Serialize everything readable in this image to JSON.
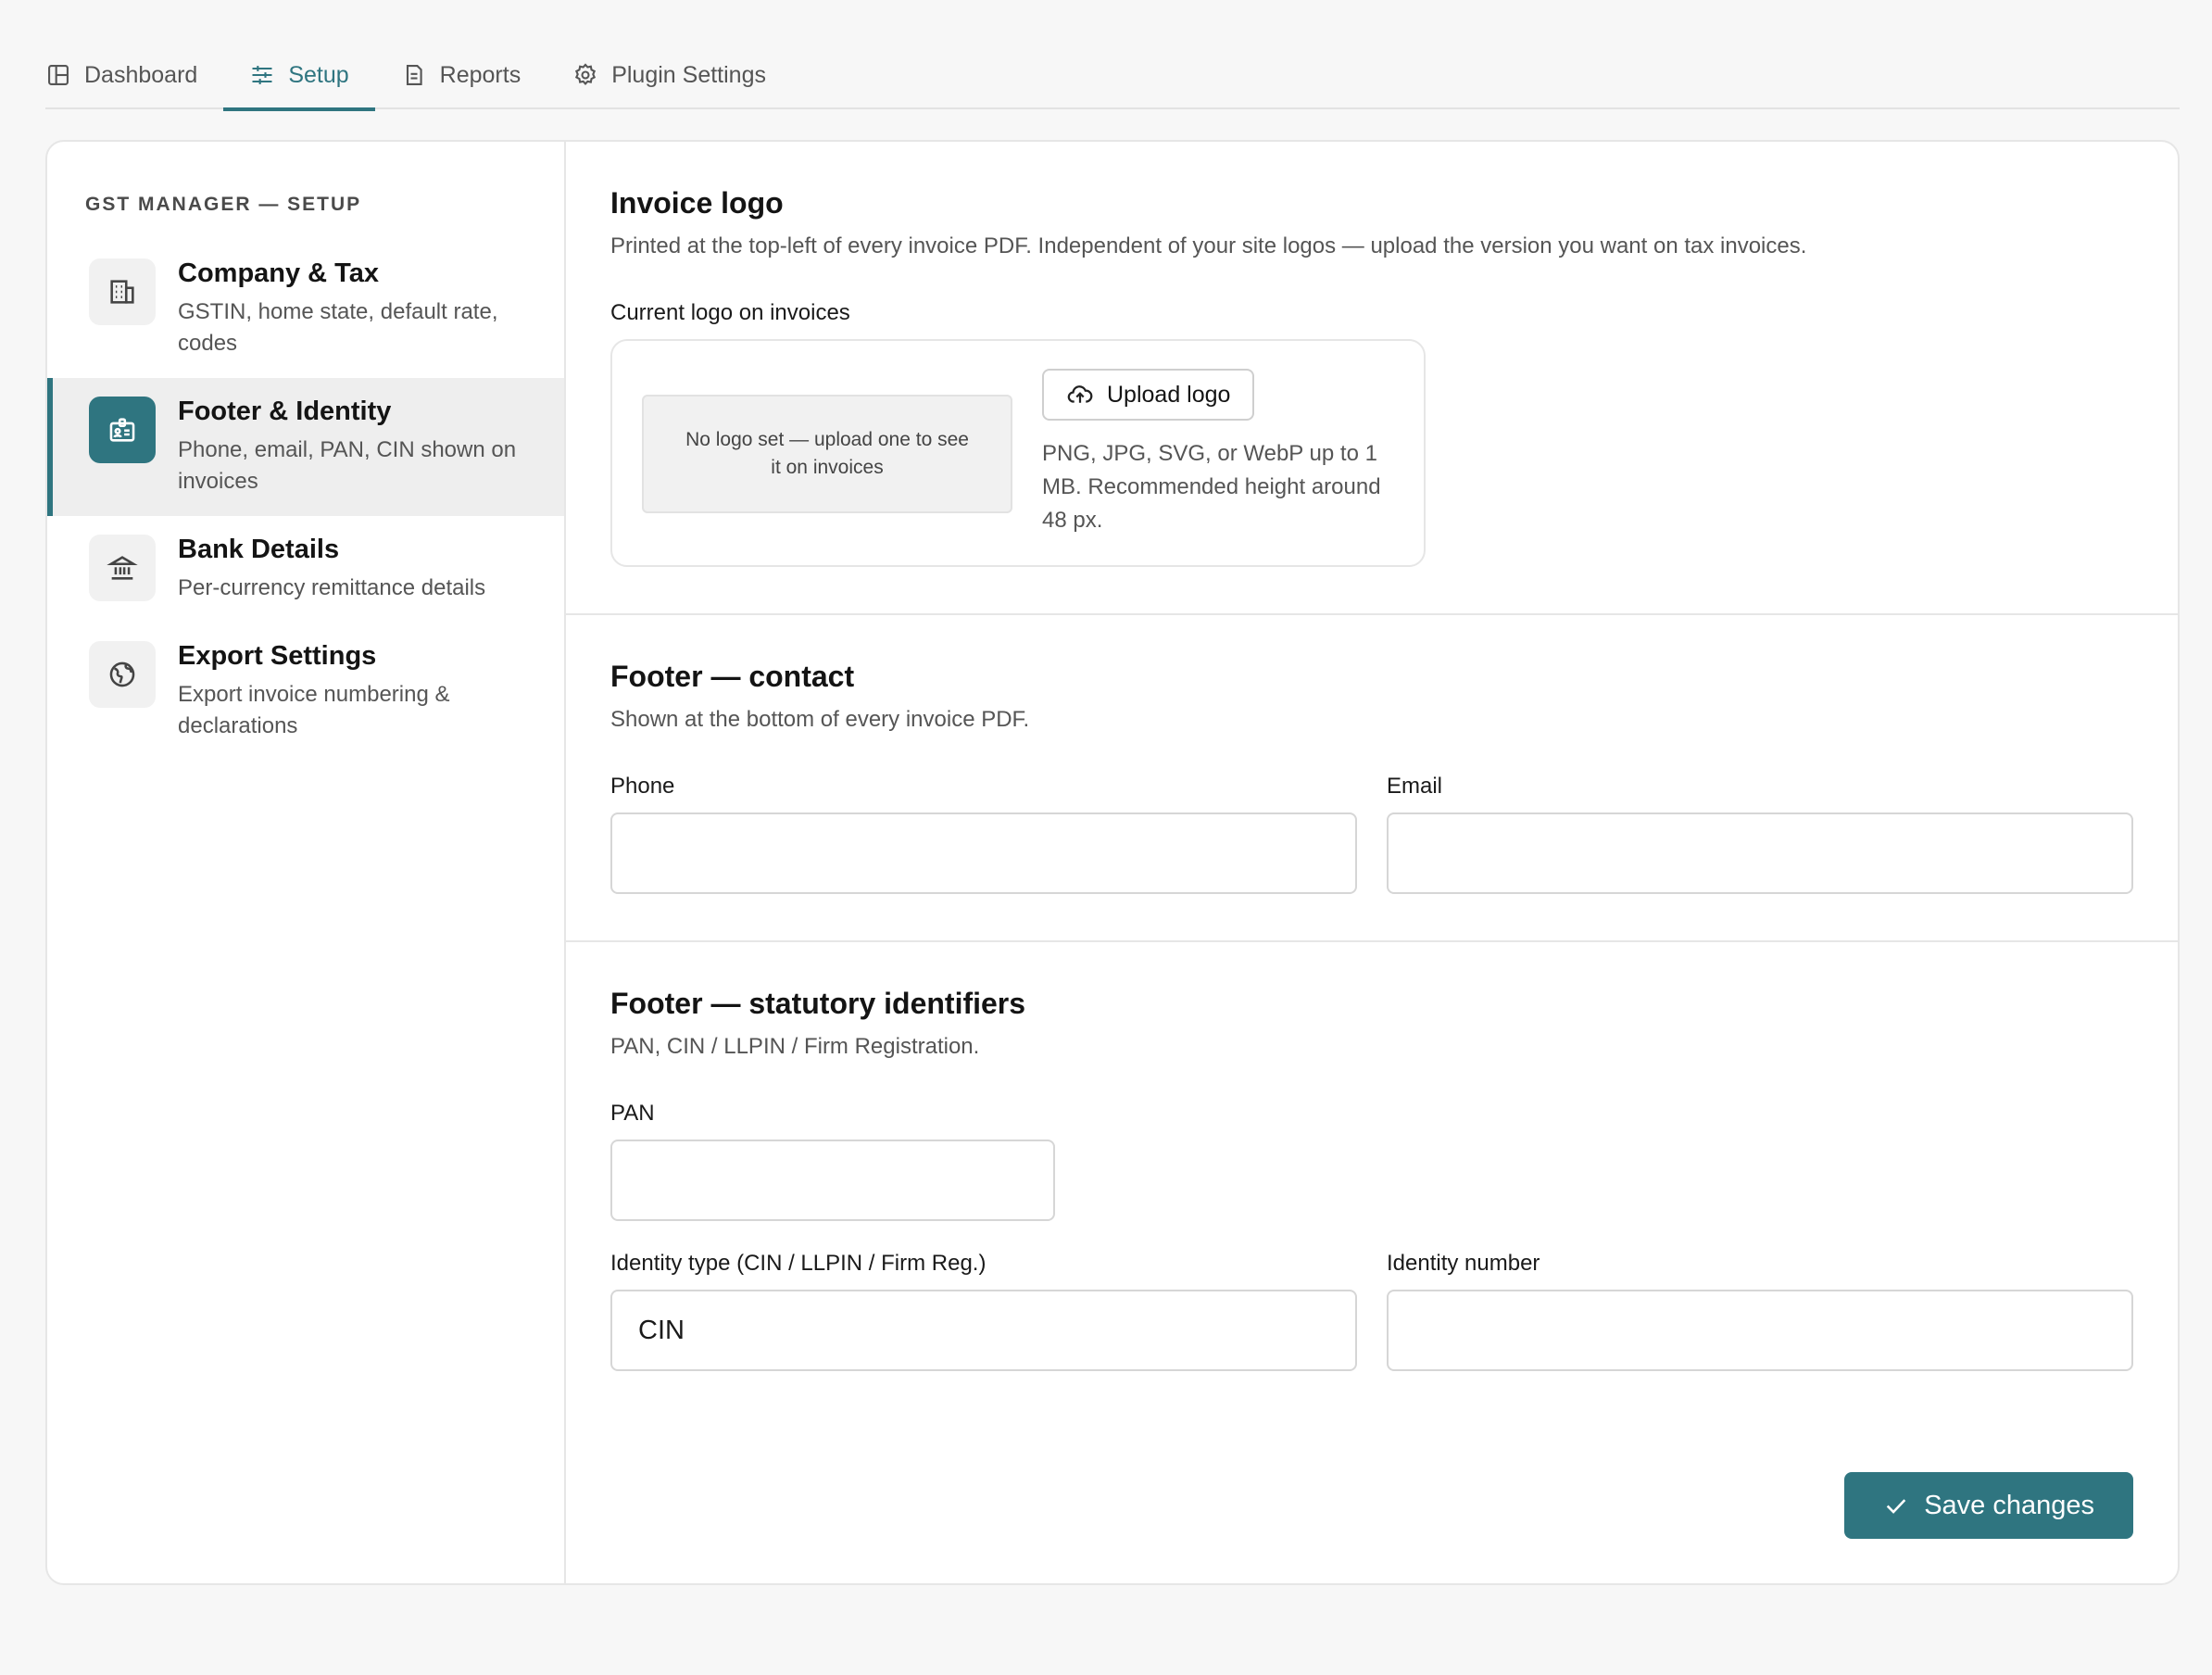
{
  "tabs": [
    {
      "label": "Dashboard",
      "icon": "layout-icon"
    },
    {
      "label": "Setup",
      "icon": "sliders-icon",
      "active": true
    },
    {
      "label": "Reports",
      "icon": "document-icon"
    },
    {
      "label": "Plugin Settings",
      "icon": "gear-icon"
    }
  ],
  "sidebar": {
    "heading": "GST MANAGER — SETUP",
    "items": [
      {
        "title": "Company & Tax",
        "subtitle": "GSTIN, home state, default rate, codes",
        "icon": "building-icon"
      },
      {
        "title": "Footer & Identity",
        "subtitle": "Phone, email, PAN, CIN shown on invoices",
        "icon": "id-card-icon",
        "active": true
      },
      {
        "title": "Bank Details",
        "subtitle": "Per-currency remittance details",
        "icon": "bank-icon"
      },
      {
        "title": "Export Settings",
        "subtitle": "Export invoice numbering & declarations",
        "icon": "globe-icon"
      }
    ]
  },
  "invoice_logo": {
    "title": "Invoice logo",
    "description": "Printed at the top-left of every invoice PDF. Independent of your site logos — upload the version you want on tax invoices.",
    "current_label": "Current logo on invoices",
    "placeholder": "No logo set — upload one to see it on invoices",
    "upload_label": "Upload logo",
    "help": "PNG, JPG, SVG, or WebP up to 1 MB. Recommended height around 48 px."
  },
  "footer_contact": {
    "title": "Footer — contact",
    "description": "Shown at the bottom of every invoice PDF.",
    "phone_label": "Phone",
    "phone_value": "",
    "email_label": "Email",
    "email_value": ""
  },
  "footer_statutory": {
    "title": "Footer — statutory identifiers",
    "description": "PAN, CIN / LLPIN / Firm Registration.",
    "pan_label": "PAN",
    "pan_value": "",
    "identity_type_label": "Identity type (CIN / LLPIN / Firm Reg.)",
    "identity_type_value": "CIN",
    "identity_number_label": "Identity number",
    "identity_number_value": ""
  },
  "save_label": "Save changes",
  "colors": {
    "accent": "#2f7580",
    "background": "#f7f7f7"
  }
}
